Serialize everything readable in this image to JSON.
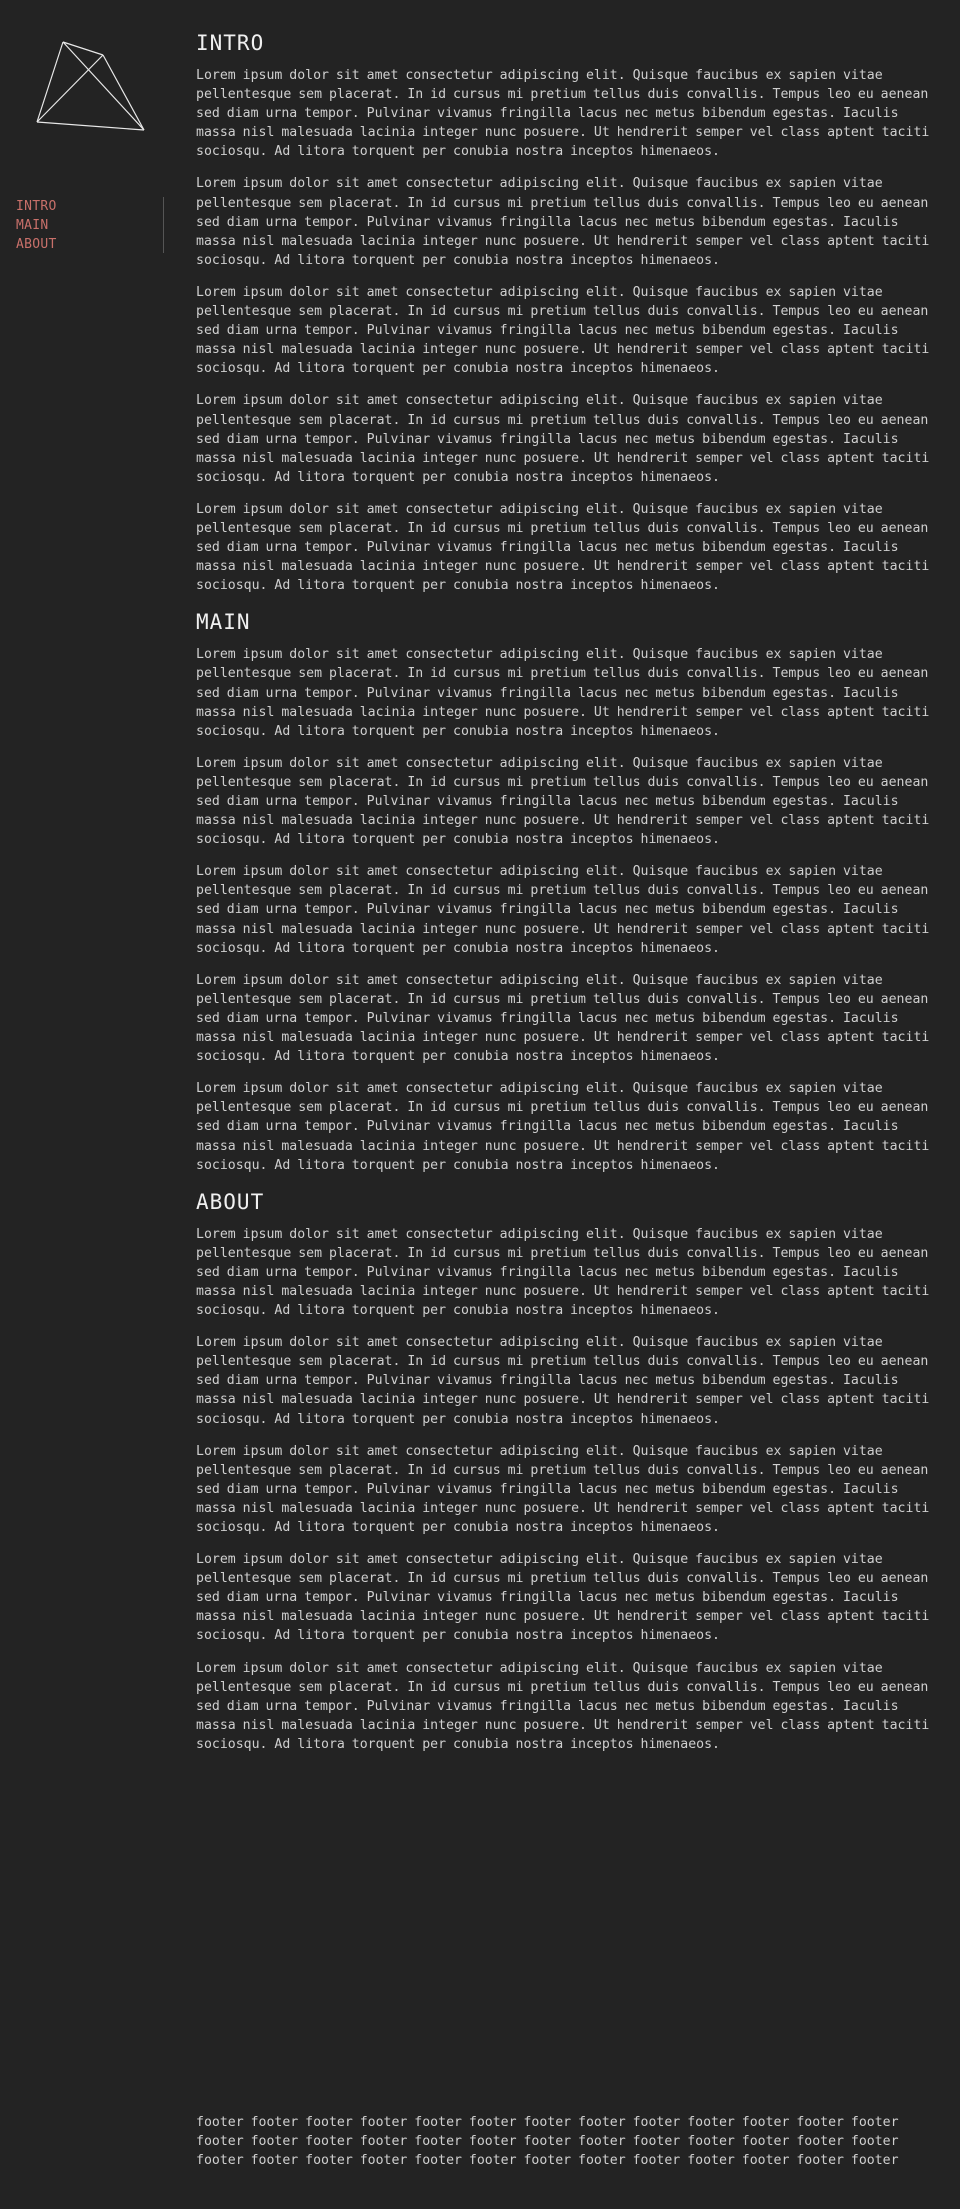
{
  "nav": {
    "items": [
      {
        "label": "INTRO"
      },
      {
        "label": "MAIN"
      },
      {
        "label": "ABOUT"
      }
    ]
  },
  "sections": {
    "intro": {
      "title": "INTRO",
      "paragraphs": [
        "Lorem ipsum dolor sit amet consectetur adipiscing elit. Quisque faucibus ex sapien vitae pellentesque sem placerat. In id cursus mi pretium tellus duis convallis. Tempus leo eu aenean sed diam urna tempor. Pulvinar vivamus fringilla lacus nec metus bibendum egestas. Iaculis massa nisl malesuada lacinia integer nunc posuere. Ut hendrerit semper vel class aptent taciti sociosqu. Ad litora torquent per conubia nostra inceptos himenaeos.",
        "Lorem ipsum dolor sit amet consectetur adipiscing elit. Quisque faucibus ex sapien vitae pellentesque sem placerat. In id cursus mi pretium tellus duis convallis. Tempus leo eu aenean sed diam urna tempor. Pulvinar vivamus fringilla lacus nec metus bibendum egestas. Iaculis massa nisl malesuada lacinia integer nunc posuere. Ut hendrerit semper vel class aptent taciti sociosqu. Ad litora torquent per conubia nostra inceptos himenaeos.",
        "Lorem ipsum dolor sit amet consectetur adipiscing elit. Quisque faucibus ex sapien vitae pellentesque sem placerat. In id cursus mi pretium tellus duis convallis. Tempus leo eu aenean sed diam urna tempor. Pulvinar vivamus fringilla lacus nec metus bibendum egestas. Iaculis massa nisl malesuada lacinia integer nunc posuere. Ut hendrerit semper vel class aptent taciti sociosqu. Ad litora torquent per conubia nostra inceptos himenaeos.",
        "Lorem ipsum dolor sit amet consectetur adipiscing elit. Quisque faucibus ex sapien vitae pellentesque sem placerat. In id cursus mi pretium tellus duis convallis. Tempus leo eu aenean sed diam urna tempor. Pulvinar vivamus fringilla lacus nec metus bibendum egestas. Iaculis massa nisl malesuada lacinia integer nunc posuere. Ut hendrerit semper vel class aptent taciti sociosqu. Ad litora torquent per conubia nostra inceptos himenaeos.",
        "Lorem ipsum dolor sit amet consectetur adipiscing elit. Quisque faucibus ex sapien vitae pellentesque sem placerat. In id cursus mi pretium tellus duis convallis. Tempus leo eu aenean sed diam urna tempor. Pulvinar vivamus fringilla lacus nec metus bibendum egestas. Iaculis massa nisl malesuada lacinia integer nunc posuere. Ut hendrerit semper vel class aptent taciti sociosqu. Ad litora torquent per conubia nostra inceptos himenaeos."
      ]
    },
    "main": {
      "title": "MAIN",
      "paragraphs": [
        "Lorem ipsum dolor sit amet consectetur adipiscing elit. Quisque faucibus ex sapien vitae pellentesque sem placerat. In id cursus mi pretium tellus duis convallis. Tempus leo eu aenean sed diam urna tempor. Pulvinar vivamus fringilla lacus nec metus bibendum egestas. Iaculis massa nisl malesuada lacinia integer nunc posuere. Ut hendrerit semper vel class aptent taciti sociosqu. Ad litora torquent per conubia nostra inceptos himenaeos.",
        "Lorem ipsum dolor sit amet consectetur adipiscing elit. Quisque faucibus ex sapien vitae pellentesque sem placerat. In id cursus mi pretium tellus duis convallis. Tempus leo eu aenean sed diam urna tempor. Pulvinar vivamus fringilla lacus nec metus bibendum egestas. Iaculis massa nisl malesuada lacinia integer nunc posuere. Ut hendrerit semper vel class aptent taciti sociosqu. Ad litora torquent per conubia nostra inceptos himenaeos.",
        "Lorem ipsum dolor sit amet consectetur adipiscing elit. Quisque faucibus ex sapien vitae pellentesque sem placerat. In id cursus mi pretium tellus duis convallis. Tempus leo eu aenean sed diam urna tempor. Pulvinar vivamus fringilla lacus nec metus bibendum egestas. Iaculis massa nisl malesuada lacinia integer nunc posuere. Ut hendrerit semper vel class aptent taciti sociosqu. Ad litora torquent per conubia nostra inceptos himenaeos.",
        "Lorem ipsum dolor sit amet consectetur adipiscing elit. Quisque faucibus ex sapien vitae pellentesque sem placerat. In id cursus mi pretium tellus duis convallis. Tempus leo eu aenean sed diam urna tempor. Pulvinar vivamus fringilla lacus nec metus bibendum egestas. Iaculis massa nisl malesuada lacinia integer nunc posuere. Ut hendrerit semper vel class aptent taciti sociosqu. Ad litora torquent per conubia nostra inceptos himenaeos.",
        "Lorem ipsum dolor sit amet consectetur adipiscing elit. Quisque faucibus ex sapien vitae pellentesque sem placerat. In id cursus mi pretium tellus duis convallis. Tempus leo eu aenean sed diam urna tempor. Pulvinar vivamus fringilla lacus nec metus bibendum egestas. Iaculis massa nisl malesuada lacinia integer nunc posuere. Ut hendrerit semper vel class aptent taciti sociosqu. Ad litora torquent per conubia nostra inceptos himenaeos."
      ]
    },
    "about": {
      "title": "ABOUT",
      "paragraphs": [
        "Lorem ipsum dolor sit amet consectetur adipiscing elit. Quisque faucibus ex sapien vitae pellentesque sem placerat. In id cursus mi pretium tellus duis convallis. Tempus leo eu aenean sed diam urna tempor. Pulvinar vivamus fringilla lacus nec metus bibendum egestas. Iaculis massa nisl malesuada lacinia integer nunc posuere. Ut hendrerit semper vel class aptent taciti sociosqu. Ad litora torquent per conubia nostra inceptos himenaeos.",
        "Lorem ipsum dolor sit amet consectetur adipiscing elit. Quisque faucibus ex sapien vitae pellentesque sem placerat. In id cursus mi pretium tellus duis convallis. Tempus leo eu aenean sed diam urna tempor. Pulvinar vivamus fringilla lacus nec metus bibendum egestas. Iaculis massa nisl malesuada lacinia integer nunc posuere. Ut hendrerit semper vel class aptent taciti sociosqu. Ad litora torquent per conubia nostra inceptos himenaeos.",
        "Lorem ipsum dolor sit amet consectetur adipiscing elit. Quisque faucibus ex sapien vitae pellentesque sem placerat. In id cursus mi pretium tellus duis convallis. Tempus leo eu aenean sed diam urna tempor. Pulvinar vivamus fringilla lacus nec metus bibendum egestas. Iaculis massa nisl malesuada lacinia integer nunc posuere. Ut hendrerit semper vel class aptent taciti sociosqu. Ad litora torquent per conubia nostra inceptos himenaeos.",
        "Lorem ipsum dolor sit amet consectetur adipiscing elit. Quisque faucibus ex sapien vitae pellentesque sem placerat. In id cursus mi pretium tellus duis convallis. Tempus leo eu aenean sed diam urna tempor. Pulvinar vivamus fringilla lacus nec metus bibendum egestas. Iaculis massa nisl malesuada lacinia integer nunc posuere. Ut hendrerit semper vel class aptent taciti sociosqu. Ad litora torquent per conubia nostra inceptos himenaeos.",
        "Lorem ipsum dolor sit amet consectetur adipiscing elit. Quisque faucibus ex sapien vitae pellentesque sem placerat. In id cursus mi pretium tellus duis convallis. Tempus leo eu aenean sed diam urna tempor. Pulvinar vivamus fringilla lacus nec metus bibendum egestas. Iaculis massa nisl malesuada lacinia integer nunc posuere. Ut hendrerit semper vel class aptent taciti sociosqu. Ad litora torquent per conubia nostra inceptos himenaeos."
      ]
    }
  },
  "footer": {
    "text": "footer footer footer footer footer footer footer footer footer footer footer footer footer footer footer footer footer footer footer footer footer footer footer footer footer footer footer footer footer footer footer footer footer footer footer footer footer footer footer"
  },
  "colors": {
    "background": "#232323",
    "text": "#cfcfcf",
    "heading": "#f0f0f0",
    "nav_link": "#c8706a"
  },
  "icons": {
    "logo": "wireframe-tetrahedron-logo"
  }
}
